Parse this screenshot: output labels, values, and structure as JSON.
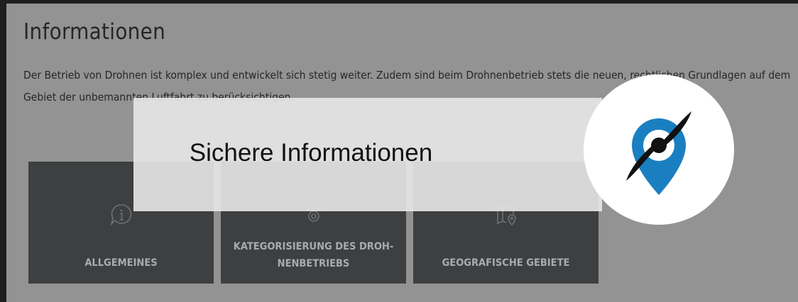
{
  "section": {
    "heading": "Informationen",
    "intro": "Der Betrieb von Drohnen ist komplex und entwickelt sich stetig weiter. Zudem sind beim Drohnenbetrieb stets die neuen, rechtlichen Grundlagen auf dem Gebiet der unbemannten Luftfahrt zu berücksichtigen."
  },
  "cards": [
    {
      "label": "ALLGEMEINES",
      "icon": "info-bubble-icon"
    },
    {
      "label": "KATEGORISIERUNG DES DROH-NENBETRIEBS",
      "icon": "drone-icon"
    },
    {
      "label": "GEOGRAFISCHE GEBIETE",
      "icon": "map-pin-icon"
    }
  ],
  "overlay": {
    "title": "Sichere Informationen",
    "logo": "propeller-location-pin-logo"
  },
  "colors": {
    "page_bg": "#939393",
    "card_bg": "#3d3f40",
    "card_text": "#a9abac",
    "logo_blue": "#1a7fc1"
  }
}
